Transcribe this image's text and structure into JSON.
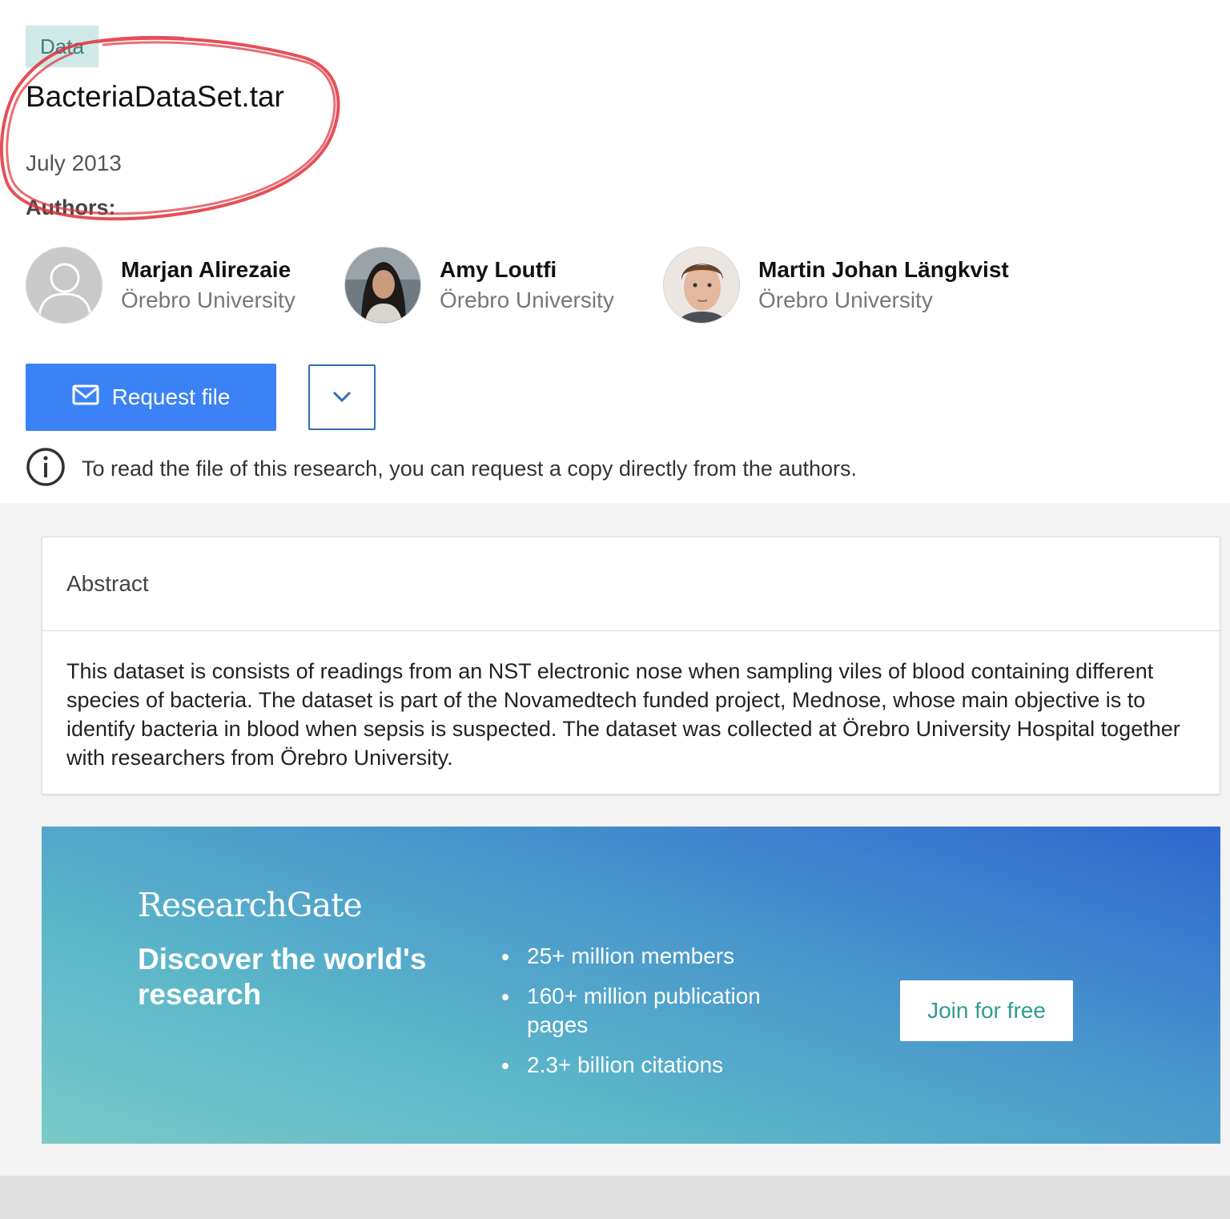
{
  "item": {
    "type_tag": "Data",
    "title": "BacteriaDataSet.tar",
    "date": "July 2013",
    "authors_label": "Authors:"
  },
  "authors": [
    {
      "name": "Marjan Alirezaie",
      "affiliation": "Örebro University",
      "avatar": "default-avatar"
    },
    {
      "name": "Amy Loutfi",
      "affiliation": "Örebro University",
      "avatar": "photo-avatar"
    },
    {
      "name": "Martin Johan Längkvist",
      "affiliation": "Örebro University",
      "avatar": "photo-avatar"
    }
  ],
  "actions": {
    "request_label": "Request file",
    "request_icon": "mail-icon",
    "more_icon": "chevron-down-icon"
  },
  "info": {
    "icon": "info-icon",
    "text": "To read the file of this research, you can request a copy directly from the authors."
  },
  "abstract": {
    "heading": "Abstract",
    "body": "This dataset is consists of readings from an NST electronic nose when sampling viles of blood containing different species of bacteria. The dataset is part of the Novamedtech funded project, Mednose, whose main objective is to identify bacteria in blood when sepsis is suspected. The dataset was collected at Örebro University Hospital together with researchers from Örebro University."
  },
  "promo": {
    "logo": "ResearchGate",
    "headline": "Discover the world's research",
    "stats": [
      "25+ million members",
      "160+ million publication pages",
      "2.3+ billion citations"
    ],
    "cta_label": "Join for free"
  },
  "colors": {
    "primary_button": "#3b82f6",
    "tag_background": "#cfe9e7",
    "cta_text": "#2f9c93",
    "annotation": "#e0303a"
  }
}
